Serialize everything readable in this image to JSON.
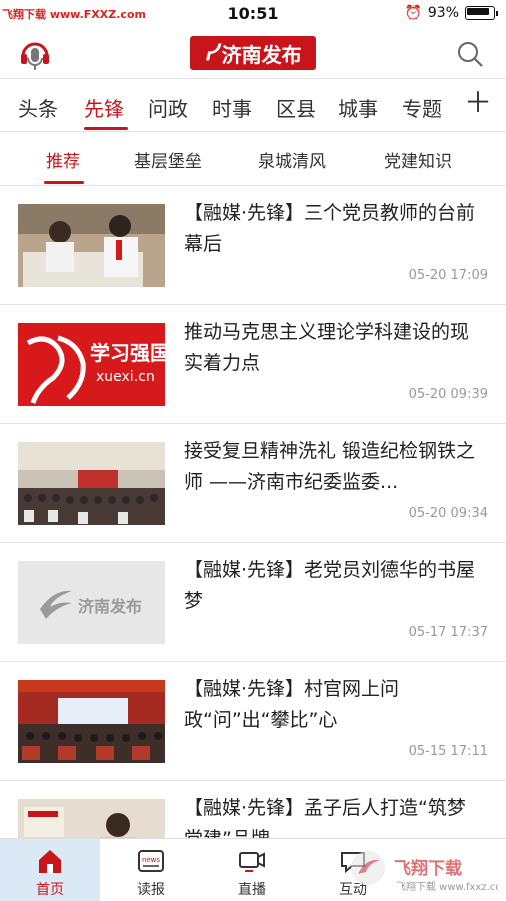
{
  "status_bar": {
    "watermark": "飞翔下载 www.FXXZ.com",
    "time": "10:51",
    "battery_percent": "93%"
  },
  "app_bar": {
    "logo_text": "济南发布",
    "left_icon": "voice-microphone-icon",
    "right_icon": "search-icon"
  },
  "channels": [
    "头条",
    "先锋",
    "问政",
    "时事",
    "区县",
    "城事",
    "专题"
  ],
  "active_channel": "先锋",
  "add_channel_icon": "plus-icon",
  "subtabs": [
    "推荐",
    "基层堡垒",
    "泉城清风",
    "党建知识"
  ],
  "active_subtab": "推荐",
  "news": [
    {
      "title": "【融媒·先锋】三个党员教师的台前幕后",
      "time": "05-20 17:09",
      "thumb": "teachers-photo"
    },
    {
      "title": "推动马克思主义理论学科建设的现实着力点",
      "time": "05-20 09:39",
      "thumb": "xuexi-qiangguo-logo",
      "thumb_text": "学习强国",
      "thumb_sub": "xuexi.cn"
    },
    {
      "title": "接受复旦精神洗礼 锻造纪检钢铁之师 ——济南市纪委监委...",
      "time": "05-20 09:34",
      "thumb": "conference-hall-photo"
    },
    {
      "title": "【融媒·先锋】老党员刘德华的书屋梦",
      "time": "05-17 17:37",
      "thumb": "jinan-fabu-placeholder",
      "thumb_text": "济南发布"
    },
    {
      "title": "【融媒·先锋】村官网上问政“问”出“攀比”心",
      "time": "05-15 17:11",
      "thumb": "meeting-stage-photo"
    },
    {
      "title": "【融媒·先锋】孟子后人打造“筑梦党建”品牌",
      "time": "",
      "thumb": "party-building-photo"
    }
  ],
  "tabbar": [
    {
      "label": "首页",
      "icon": "home-icon"
    },
    {
      "label": "读报",
      "icon": "newspaper-icon"
    },
    {
      "label": "直播",
      "icon": "live-video-icon"
    },
    {
      "label": "互动",
      "icon": "chat-icon"
    },
    {
      "label": "",
      "icon": ""
    }
  ],
  "bottom_watermark": "飞翔下载 www.fxxz.com",
  "colors": {
    "brand_red": "#c8151b",
    "active_tab_bg": "#dbe9f7"
  }
}
